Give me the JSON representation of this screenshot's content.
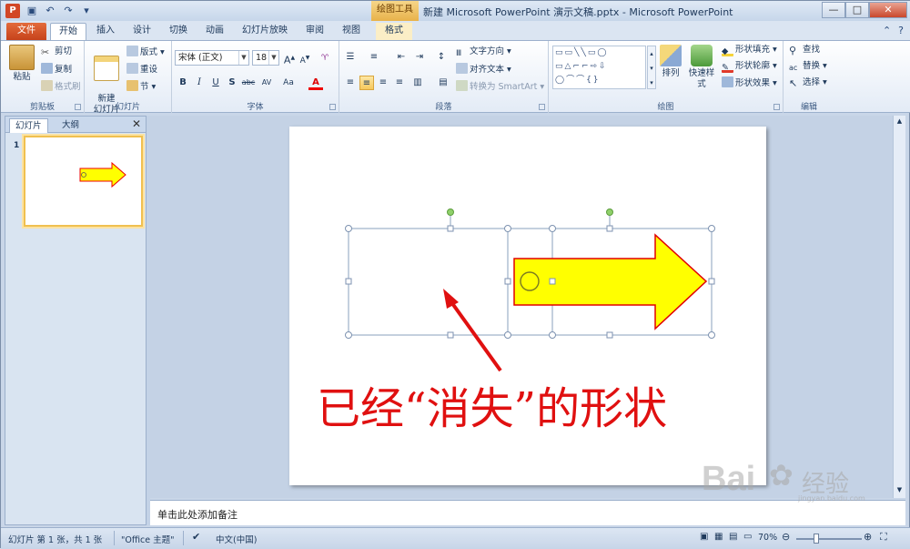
{
  "window": {
    "app_icon_letter": "P",
    "title": "新建 Microsoft PowerPoint 演示文稿.pptx - Microsoft PowerPoint",
    "context_tab_group": "绘图工具",
    "controls": [
      "—",
      "□",
      "✕"
    ]
  },
  "quick_access": [
    "save-icon",
    "undo-icon",
    "redo-icon",
    "customize-icon"
  ],
  "tabs": [
    {
      "label": "文件",
      "kind": "file"
    },
    {
      "label": "开始",
      "active": true
    },
    {
      "label": "插入"
    },
    {
      "label": "设计"
    },
    {
      "label": "切换"
    },
    {
      "label": "动画"
    },
    {
      "label": "幻灯片放映"
    },
    {
      "label": "审阅"
    },
    {
      "label": "视图"
    },
    {
      "label": "格式"
    }
  ],
  "ribbon": {
    "clipboard": {
      "label": "剪贴板",
      "paste": "粘贴",
      "cut": "剪切",
      "copy": "复制",
      "format_painter": "格式刷"
    },
    "slides": {
      "label": "幻灯片",
      "new_slide": "新建\n幻灯片",
      "layout": "版式",
      "reset": "重设",
      "section": "节"
    },
    "font": {
      "label": "字体",
      "font_name": "宋体 (正文)",
      "font_size": "18"
    },
    "paragraph": {
      "label": "段落",
      "text_direction": "文字方向",
      "align_text": "对齐文本",
      "convert_smartart": "转换为 SmartArt"
    },
    "drawing": {
      "label": "绘图",
      "arrange": "排列",
      "quick_styles": "快速样式",
      "shape_fill": "形状填充",
      "shape_outline": "形状轮廓",
      "shape_effects": "形状效果"
    },
    "editing": {
      "label": "编辑",
      "find": "查找",
      "replace": "替换",
      "select": "选择"
    }
  },
  "left_pane": {
    "tab_slides": "幻灯片",
    "tab_outline": "大纲",
    "slide_number": "1"
  },
  "slide": {
    "annotation_text": "已经“消失”的形状",
    "arrow_fill": "#ffff00",
    "arrow_stroke": "#ff0000",
    "annotation_color": "#e01010"
  },
  "notes_placeholder": "单击此处添加备注",
  "status_bar": {
    "slide_info": "幻灯片 第 1 张，共 1 张",
    "theme": "\"Office 主题\"",
    "language": "中文(中国)",
    "zoom": "70%"
  },
  "watermark": {
    "text": "Bai",
    "suffix": "经验",
    "sub": "jingyan.baidu.com"
  }
}
